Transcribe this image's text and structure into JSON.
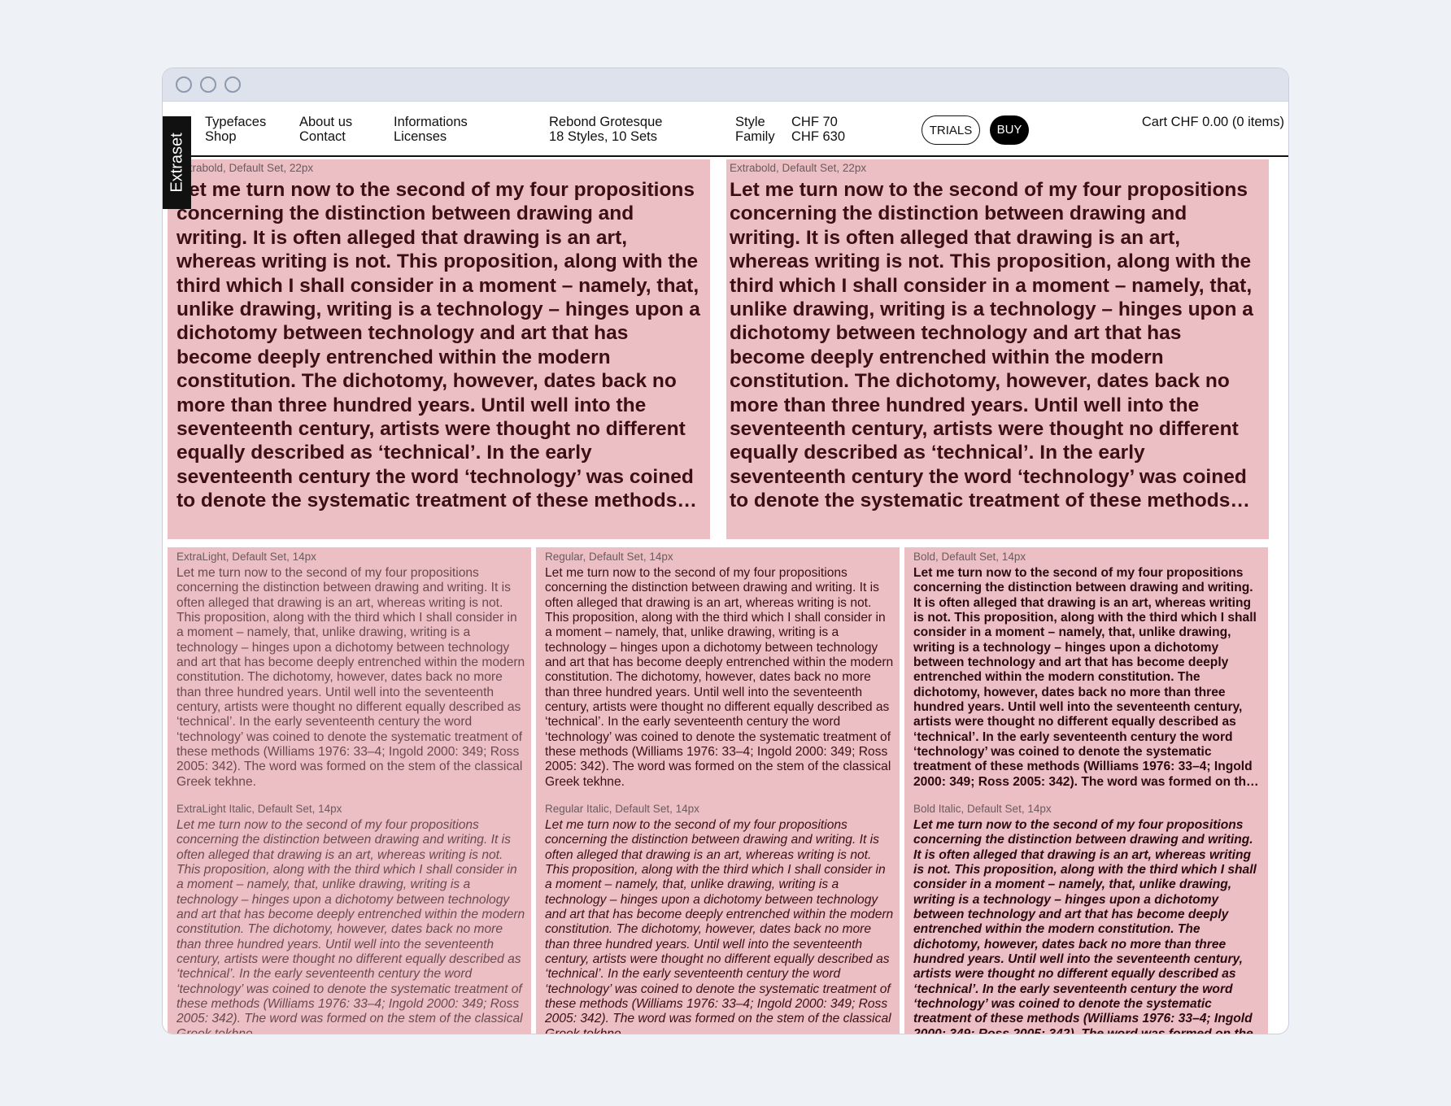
{
  "window": {
    "controls": [
      "window-dot",
      "window-dot",
      "window-dot"
    ]
  },
  "nav": {
    "typefaces": "Typefaces",
    "shop": "Shop",
    "about": "About us",
    "contact": "Contact",
    "informations": "Informations",
    "licenses": "Licenses",
    "font_name": "Rebond Grotesque",
    "font_meta": "18 Styles, 10 Sets",
    "style_label": "Style",
    "family_label": "Family",
    "style_price": "CHF 70",
    "family_price": "CHF 630",
    "trials": "TRIALS",
    "buy": "BUY",
    "cart": "Cart CHF 0.00 (0 items)"
  },
  "side_tag": "Extraset",
  "samples": {
    "big_left": {
      "label": "Extrabold, Default Set, 22px",
      "text": "Let me turn now to the second of my four propositions concerning the distinction between drawing and writing. It is often alleged that drawing is an art, whereas writing is not. This proposition, along with the third which I shall consider in a moment – namely, that, unlike drawing, writing is a technology – hinges upon a dichotomy between technology and art that has become deeply entrenched within the modern constitution. The dichotomy, however, dates back no more than three hundred years. Until well into the seventeenth century, artists were thought no different equally described as ‘technical’. In the early seventeenth century the word ‘technology’ was coined to denote the systematic treatment of these methods (Williams 1976: 33–4; Ingold 2000: 349; Ross 2005: 342). The word was formed on the stem of the classical Greek tekhne."
    },
    "big_right": {
      "label": "Extrabold, Default Set, 22px",
      "text": "Let me turn now to the second of my four propositions concerning the distinction between drawing and writing. It is often alleged that drawing is an art, whereas writing is not. This proposition, along with the third which I shall consider in a moment – namely, that, unlike drawing, writing is a technology – hinges upon a dichotomy between technology and art that has become deeply entrenched within the modern constitution. The dichotomy, however, dates back no more than three hundred years. Until well into the seventeenth century, artists were thought no different equally described as ‘technical’. In the early seventeenth century the word ‘technology’ was coined to denote the systematic treatment of these methods (Williams 1976: 33–4; Ingold 2000: 349; Ross 2005: 342). The word was formed on the stem of the classical Greek tekhne."
    },
    "extralight": {
      "label": "ExtraLight, Default Set, 14px",
      "text": "Let me turn now to the second of my four propositions concerning the distinction between drawing and writing. It is often alleged that drawing is an art, whereas writing is not. This proposition, along with the third which I shall consider in a moment – namely, that, unlike drawing, writing is a technology – hinges upon a dichotomy between technology and art that has become deeply entrenched within the modern constitution. The dichotomy, however, dates back no more than three hundred years. Until well into the seventeenth century, artists were thought no different equally described as ‘technical’. In the early seventeenth century the word ‘technology’ was coined to denote the systematic treatment of these methods (Williams 1976: 33–4; Ingold 2000: 349; Ross 2005: 342). The word was formed on the stem of the classical Greek tekhne."
    },
    "regular": {
      "label": "Regular, Default Set, 14px",
      "text": "Let me turn now to the second of my four propositions concerning the distinction between drawing and writing. It is often alleged that drawing is an art, whereas writing is not. This proposition, along with the third which I shall consider in a moment – namely, that, unlike drawing, writing is a technology – hinges upon a dichotomy between technology and art that has become deeply entrenched within the modern constitution. The dichotomy, however, dates back no more than three hundred years. Until well into the seventeenth century, artists were thought no different equally described as ‘technical’. In the early seventeenth century the word ‘technology’ was coined to denote the systematic treatment of these methods (Williams 1976: 33–4; Ingold 2000: 349; Ross 2005: 342). The word was formed on the stem of the classical Greek tekhne."
    },
    "bold": {
      "label": "Bold, Default Set, 14px",
      "text": "Let me turn now to the second of my four propositions concerning the distinction between drawing and writing. It is often alleged that drawing is an art, whereas writing is not. This proposition, along with the third which I shall consider in a moment – namely, that, unlike drawing, writing is a technology – hinges upon a dichotomy between technology and art that has become deeply entrenched within the modern constitution. The dichotomy, however, dates back no more than three hundred years. Until well into the seventeenth century, artists were thought no different equally described as ‘technical’. In the early seventeenth century the word ‘technology’ was coined to denote the systematic treatment of these methods (Williams 1976: 33–4; Ingold 2000: 349; Ross 2005: 342). The word was formed on the stem of the classical Greek tekhne."
    },
    "extralight_italic": {
      "label": "ExtraLight Italic, Default Set, 14px",
      "text": "Let me turn now to the second of my four propositions concerning the distinction between drawing and writing. It is often alleged that drawing is an art, whereas writing is not. This proposition, along with the third which I shall consider in a moment – namely, that, unlike drawing, writing is a technology – hinges upon a dichotomy between technology and art that has become deeply entrenched within the modern constitution. The dichotomy, however, dates back no more than three hundred years. Until well into the seventeenth century, artists were thought no different equally described as ‘technical’. In the early seventeenth century the word ‘technology’ was coined to denote the systematic treatment of these methods (Williams 1976: 33–4; Ingold 2000: 349; Ross 2005: 342). The word was formed on the stem of the classical Greek tekhne."
    },
    "regular_italic": {
      "label": "Regular Italic, Default Set, 14px",
      "text": "Let me turn now to the second of my four propositions concerning the distinction between drawing and writing. It is often alleged that drawing is an art, whereas writing is not. This proposition, along with the third which I shall consider in a moment – namely, that, unlike drawing, writing is a technology – hinges upon a dichotomy between technology and art that has become deeply entrenched within the modern constitution. The dichotomy, however, dates back no more than three hundred years. Until well into the seventeenth century, artists were thought no different equally described as ‘technical’. In the early seventeenth century the word ‘technology’ was coined to denote the systematic treatment of these methods (Williams 1976: 33–4; Ingold 2000: 349; Ross 2005: 342). The word was formed on the stem of the classical Greek tekhne."
    },
    "bold_italic": {
      "label": "Bold Italic, Default Set, 14px",
      "text": "Let me turn now to the second of my four propositions concerning the distinction between drawing and writing. It is often alleged that drawing is an art, whereas writing is not. This proposition, along with the third which I shall consider in a moment – namely, that, unlike drawing, writing is a technology – hinges upon a dichotomy between technology and art that has become deeply entrenched within the modern constitution. The dichotomy, however, dates back no more than three hundred years. Until well into the seventeenth century, artists were thought no different equally described as ‘technical’. In the early seventeenth century the word ‘technology’ was coined to denote the systematic treatment of these methods (Williams 1976: 33–4; Ingold 2000: 349; Ross 2005: 342). The word was formed on the stem of the classical Greek tekhne."
    }
  },
  "colors": {
    "panel_bg": "#ebbfc3",
    "text_dark": "#3a1015",
    "page_bg": "#eef2f6",
    "buy_bg": "#000000"
  }
}
